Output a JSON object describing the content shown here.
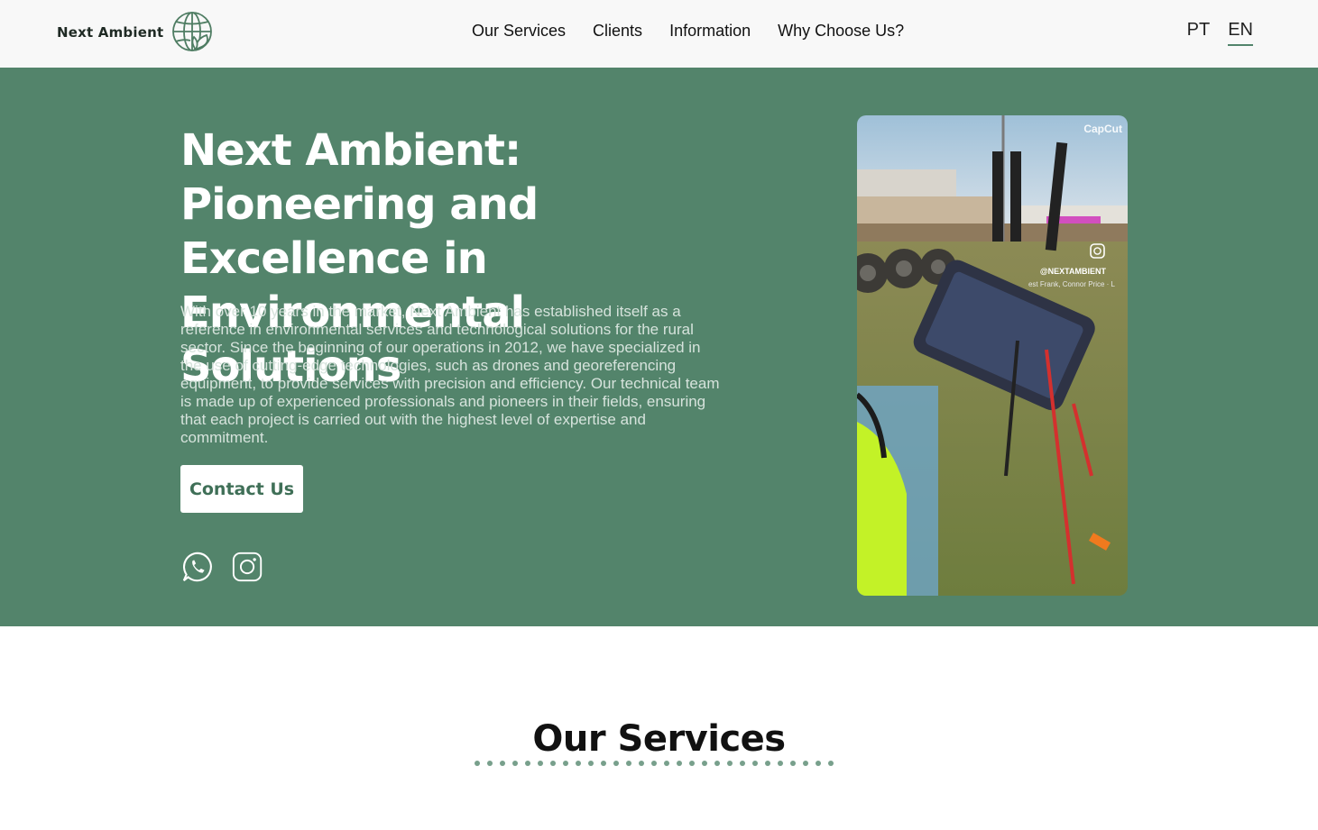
{
  "brand": {
    "name": "Next Ambient",
    "logo_icon": "globe-leaf-icon"
  },
  "nav": {
    "items": [
      {
        "label": "Our Services"
      },
      {
        "label": "Clients"
      },
      {
        "label": "Information"
      },
      {
        "label": "Why Choose Us?"
      }
    ]
  },
  "lang": {
    "pt": "PT",
    "en": "EN",
    "active": "EN"
  },
  "hero": {
    "title": "Next Ambient: Pioneering and Excellence in Environmental Solutions",
    "description": "With over 10 years in the market, Next Ambient has established itself as a reference in environmental services and technological solutions for the rural sector. Since the beginning of our operations in 2012, we have specialized in the use of cutting-edge technologies, such as drones and georeferencing equipment, to provide services with precision and efficiency. Our technical team is made up of experienced professionals and pioneers in their fields, ensuring that each project is carried out with the highest level of expertise and commitment.",
    "cta_label": "Contact Us",
    "social": [
      "whatsapp-icon",
      "instagram-icon"
    ],
    "media": {
      "watermark": "CapCut",
      "handle": "@NEXTAMBIENT",
      "music": "est Frank, Connor Price · L"
    }
  },
  "services": {
    "title": "Our Services"
  },
  "colors": {
    "primary": "#53846b",
    "header_bg": "#f8f8f8",
    "dots": "#78a08c"
  }
}
